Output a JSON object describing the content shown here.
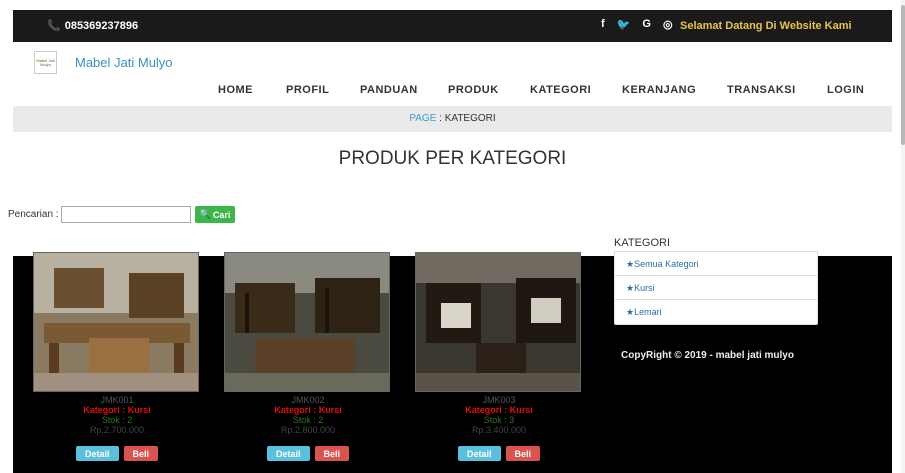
{
  "topbar": {
    "phone": "085369237896",
    "social_icons": [
      "facebook-icon",
      "twitter-icon",
      "google-icon",
      "instagram-icon"
    ],
    "social_glyphs": [
      "f",
      "🐦",
      "G",
      "◎"
    ],
    "welcome": "Selamat Datang Di Website Kami"
  },
  "brand": {
    "name": "Mabel Jati Mulyo",
    "logo_text": "Mabel Jati Mulyo"
  },
  "nav": {
    "items": [
      "HOME",
      "PROFIL",
      "PANDUAN",
      "PRODUK",
      "KATEGORI",
      "KERANJANG",
      "TRANSAKSI",
      "LOGIN"
    ]
  },
  "pagebar": {
    "prefix": "PAGE",
    "separator": " : ",
    "current": "KATEGORI"
  },
  "main": {
    "title": "PRODUK PER KATEGORI"
  },
  "search": {
    "label": "Pencarian :",
    "value": "",
    "placeholder": "",
    "button": "Cari"
  },
  "products": [
    {
      "code": "JMK001",
      "category": "Kategori : Kursi",
      "stock": "Stok : 2",
      "price": "Rp.2.700.000",
      "detail": "Detail",
      "buy": "Beli"
    },
    {
      "code": "JMK002",
      "category": "Kategori : Kursi",
      "stock": "Stok : 2",
      "price": "Rp.2.800.000",
      "detail": "Detail",
      "buy": "Beli"
    },
    {
      "code": "JMK003",
      "category": "Kategori : Kursi",
      "stock": "Stok : 3",
      "price": "Rp.3.400.000",
      "detail": "Detail",
      "buy": "Beli"
    }
  ],
  "sidebar": {
    "title": "KATEGORI",
    "items": [
      "Semua Kategori",
      "Kursi",
      "Lemari"
    ]
  },
  "footer": {
    "copyright": "CopyRight © 2019 - mabel jati mulyo"
  },
  "colors": {
    "topbar_bg": "#1a1a1a",
    "accent_blue": "#3a8fc7",
    "welcome_yellow": "#e8c34a",
    "search_green": "#3cb54a",
    "detail_blue": "#5bc0de",
    "buy_red": "#d9534f"
  }
}
